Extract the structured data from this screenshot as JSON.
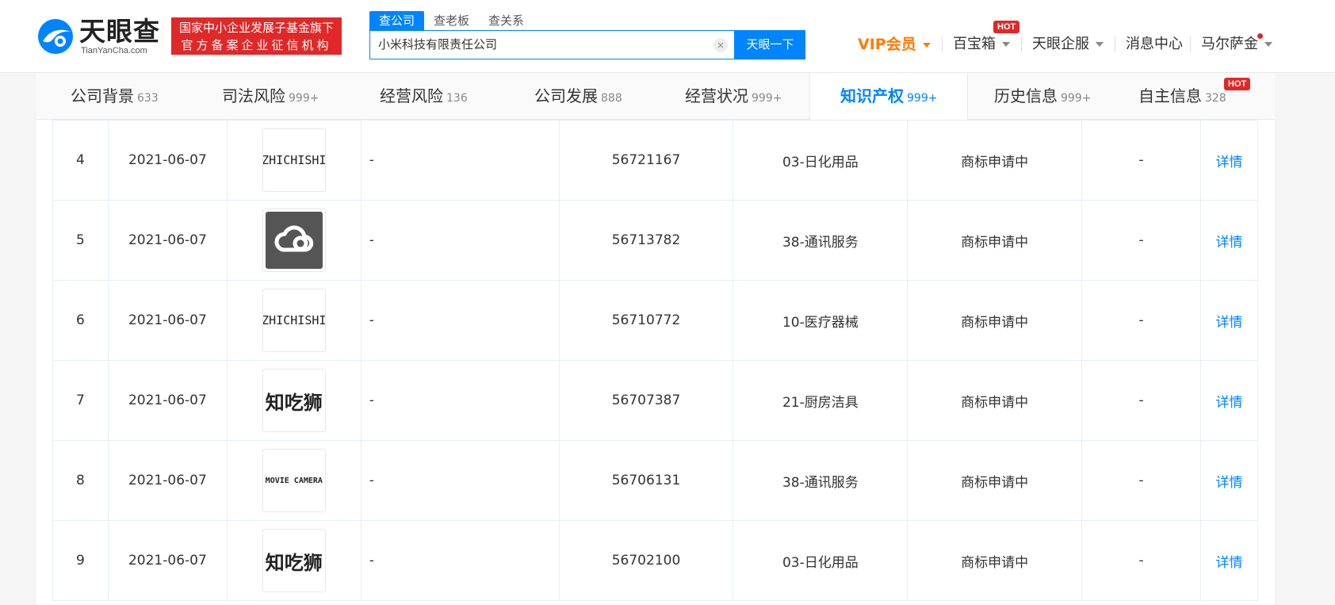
{
  "header": {
    "logo_text": "天眼查",
    "logo_sub": "TianYanCha.com",
    "badge_line1": "国家中小企业发展子基金旗下",
    "badge_line2": "官方备案企业征信机构",
    "search_tabs": [
      "查公司",
      "查老板",
      "查关系"
    ],
    "search_value": "小米科技有限责任公司",
    "search_button": "天眼一下",
    "clear_glyph": "×",
    "nav": {
      "vip": "VIP会员",
      "treasure": "百宝箱",
      "service": "天眼企服",
      "messages": "消息中心",
      "user": "马尔萨金",
      "hot": "HOT"
    }
  },
  "categories": [
    {
      "label": "公司背景",
      "count": "633"
    },
    {
      "label": "司法风险",
      "count": "999+"
    },
    {
      "label": "经营风险",
      "count": "136"
    },
    {
      "label": "公司发展",
      "count": "888"
    },
    {
      "label": "经营状况",
      "count": "999+"
    },
    {
      "label": "知识产权",
      "count": "999+"
    },
    {
      "label": "历史信息",
      "count": "999+"
    },
    {
      "label": "自主信息",
      "count": "328"
    }
  ],
  "category_hot": "HOT",
  "rows": [
    {
      "no": "4",
      "date": "2021-06-07",
      "mark": "ZHICHISHI",
      "mark_type": "latin",
      "name": "-",
      "reg_no": "56721167",
      "class": "03-日化用品",
      "status": "商标申请中",
      "extra": "-",
      "action": "详情"
    },
    {
      "no": "5",
      "date": "2021-06-07",
      "mark": "",
      "mark_type": "cloud",
      "name": "-",
      "reg_no": "56713782",
      "class": "38-通讯服务",
      "status": "商标申请中",
      "extra": "-",
      "action": "详情"
    },
    {
      "no": "6",
      "date": "2021-06-07",
      "mark": "ZHICHISHI",
      "mark_type": "latin",
      "name": "-",
      "reg_no": "56710772",
      "class": "10-医疗器械",
      "status": "商标申请中",
      "extra": "-",
      "action": "详情"
    },
    {
      "no": "7",
      "date": "2021-06-07",
      "mark": "知吃狮",
      "mark_type": "cjk",
      "name": "-",
      "reg_no": "56707387",
      "class": "21-厨房洁具",
      "status": "商标申请中",
      "extra": "-",
      "action": "详情"
    },
    {
      "no": "8",
      "date": "2021-06-07",
      "mark": "MOVIE CAMERA",
      "mark_type": "latin-small",
      "name": "-",
      "reg_no": "56706131",
      "class": "38-通讯服务",
      "status": "商标申请中",
      "extra": "-",
      "action": "详情"
    },
    {
      "no": "9",
      "date": "2021-06-07",
      "mark": "知吃狮",
      "mark_type": "cjk",
      "name": "-",
      "reg_no": "56702100",
      "class": "03-日化用品",
      "status": "商标申请中",
      "extra": "-",
      "action": "详情"
    }
  ],
  "colors": {
    "brand": "#0084ff",
    "hot": "#e02828",
    "vip": "#ff7b00"
  }
}
